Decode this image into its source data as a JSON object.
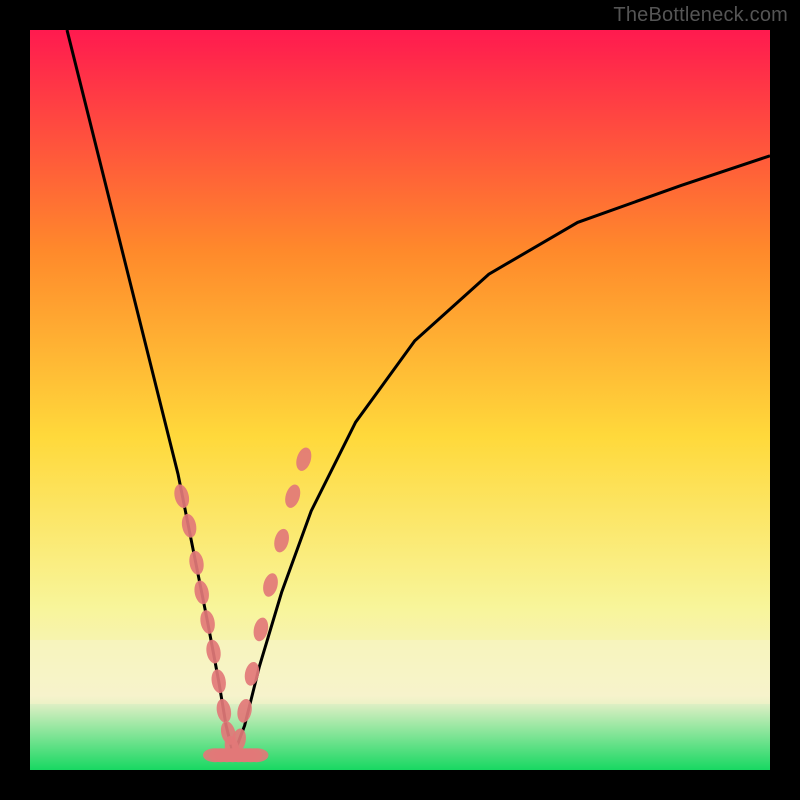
{
  "watermark": "TheBottleneck.com",
  "chart_data": {
    "type": "line",
    "title": "",
    "xlabel": "",
    "ylabel": "",
    "xlim": [
      0,
      100
    ],
    "ylim": [
      0,
      100
    ],
    "background_gradient": {
      "top": "#ff1a4f",
      "upper_mid": "#ff8a2b",
      "mid": "#ffd93b",
      "lower_mid": "#f8f59a",
      "band": "#f5f2d0",
      "bottom": "#17d862"
    },
    "curve_left": {
      "name": "bottleneck-left",
      "x": [
        5,
        8,
        11,
        14,
        17,
        20,
        22,
        24,
        25.5,
        26.5,
        27.5
      ],
      "y": [
        100,
        88,
        76,
        64,
        52,
        40,
        30,
        20,
        12,
        6,
        2
      ]
    },
    "curve_right": {
      "name": "bottleneck-right",
      "x": [
        27.5,
        29,
        31,
        34,
        38,
        44,
        52,
        62,
        74,
        88,
        100
      ],
      "y": [
        2,
        6,
        14,
        24,
        35,
        47,
        58,
        67,
        74,
        79,
        83
      ]
    },
    "datapoints_left": {
      "name": "marker-cluster-left",
      "color": "#e27878",
      "x": [
        20.5,
        21.5,
        22.5,
        23.2,
        24.0,
        24.8,
        25.5,
        26.2,
        26.8,
        27.3
      ],
      "y": [
        37,
        33,
        28,
        24,
        20,
        16,
        12,
        8,
        5,
        3
      ]
    },
    "datapoints_right": {
      "name": "marker-cluster-right",
      "color": "#e27878",
      "x": [
        28.2,
        29.0,
        30.0,
        31.2,
        32.5,
        34.0,
        35.5,
        37.0
      ],
      "y": [
        4,
        8,
        13,
        19,
        25,
        31,
        37,
        42
      ]
    },
    "datapoints_bottom": {
      "name": "marker-cluster-bottom",
      "color": "#e27878",
      "x": [
        25.0,
        25.8,
        26.6,
        27.4,
        28.2,
        29.0,
        29.8,
        30.6
      ],
      "y": [
        2,
        2,
        2,
        2,
        2,
        2,
        2,
        2
      ]
    }
  }
}
